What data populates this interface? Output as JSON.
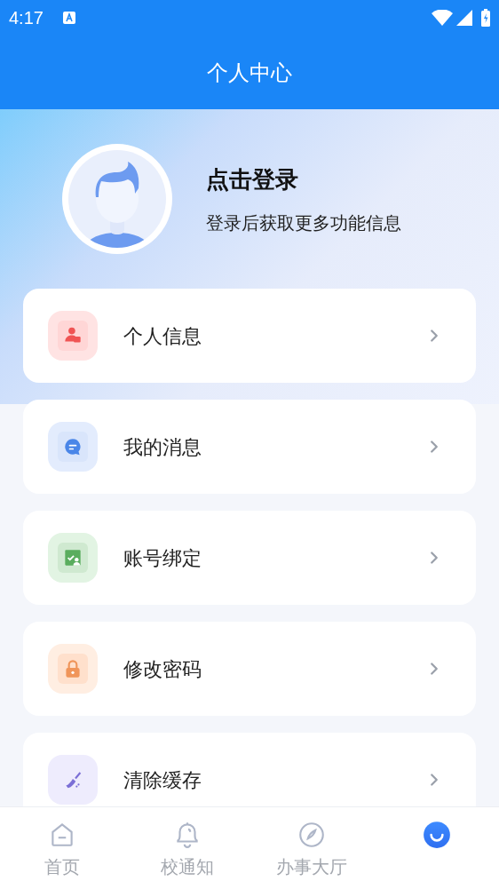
{
  "status_bar": {
    "time": "4:17"
  },
  "header": {
    "title": "个人中心"
  },
  "profile": {
    "name": "点击登录",
    "subtitle": "登录后获取更多功能信息"
  },
  "menu": [
    {
      "label": "个人信息",
      "kind": "person",
      "color": "#f05454"
    },
    {
      "label": "我的消息",
      "kind": "message",
      "color": "#4a86e8"
    },
    {
      "label": "账号绑定",
      "kind": "binding",
      "color": "#5aad5e"
    },
    {
      "label": "修改密码",
      "kind": "lock",
      "color": "#f0955a"
    },
    {
      "label": "清除缓存",
      "kind": "broom",
      "color": "#7b6fd6"
    }
  ],
  "tabs": [
    {
      "label": "首页",
      "kind": "home",
      "selected": false
    },
    {
      "label": "校通知",
      "kind": "bell",
      "selected": false
    },
    {
      "label": "办事大厅",
      "kind": "compass",
      "selected": false
    },
    {
      "kind": "me",
      "selected": true
    }
  ]
}
